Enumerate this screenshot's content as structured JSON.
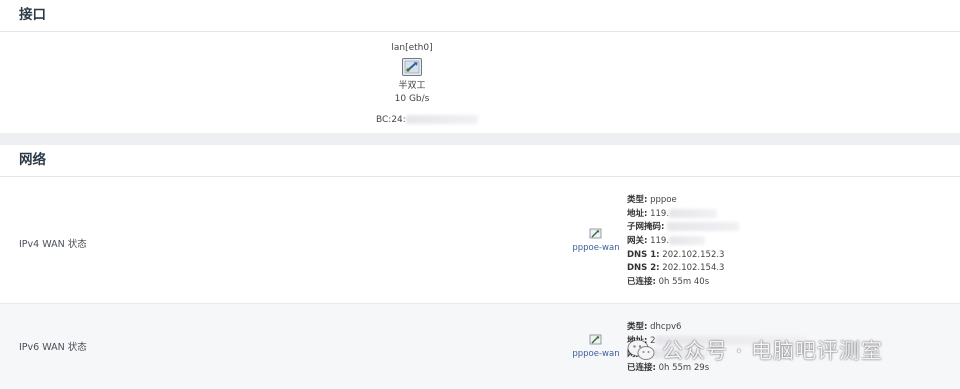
{
  "interfaces_section": {
    "title": "接口",
    "port": {
      "name": "lan[eth0]",
      "icon": "ethernet-port-icon",
      "duplex": "半双工",
      "speed": "10 Gb/s",
      "mac_prefix": "BC:24:"
    }
  },
  "network_section": {
    "title": "网络",
    "ipv4": {
      "label": "IPv4 WAN 状态",
      "interface": "pppoe-wan",
      "icon": "wan-interface-icon",
      "type_label": "类型:",
      "type_value": "pppoe",
      "address_label": "地址:",
      "address_value": "119.",
      "netmask_label": "子网掩码:",
      "gateway_label": "网关:",
      "gateway_value": "119.",
      "dns1_label": "DNS 1:",
      "dns1_value": "202.102.152.3",
      "dns2_label": "DNS 2:",
      "dns2_value": "202.102.154.3",
      "connected_label": "已连接:",
      "connected_value": "0h 55m 40s"
    },
    "ipv6": {
      "label": "IPv6 WAN 状态",
      "interface": "pppoe-wan",
      "icon": "wan-interface-icon",
      "type_label": "类型:",
      "type_value": "dhcpv6",
      "address_label": "地址:",
      "address_value": "2",
      "gateway_label": "网关:",
      "connected_label": "已连接:",
      "connected_value": "0h 55m 29s"
    }
  },
  "watermark": {
    "text": "公众号 · 电脑吧评测室",
    "icon": "wechat-icon"
  }
}
